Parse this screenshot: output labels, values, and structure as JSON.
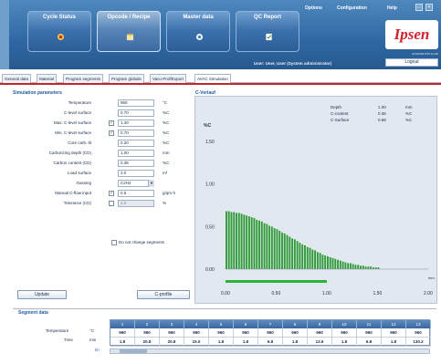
{
  "header": {
    "nav": [
      {
        "label": "Cycle Status",
        "icon": "cycle-status-icon"
      },
      {
        "label": "Opcode / Recipe",
        "icon": "recipe-icon"
      },
      {
        "label": "Master data",
        "icon": "master-data-icon"
      },
      {
        "label": "QC Report",
        "icon": "qc-report-icon"
      }
    ],
    "menu": [
      "Options",
      "Configuration",
      "Help"
    ],
    "logo": "Ipsen",
    "datetime": "4/24/2009 8:55:11 AM",
    "user": "User: User, User (System administrator)",
    "logout": "Logout"
  },
  "tabs": [
    "General data",
    "Material",
    "Program segments",
    "Program globals",
    "Vacu-Prof/Export",
    "AVAC Simulation"
  ],
  "sim": {
    "title": "Simulation parameters",
    "rows": [
      {
        "label": "Temperature",
        "value": "960",
        "unit": "°C",
        "check": false,
        "checked": false,
        "disabled": false
      },
      {
        "label": "C-level surface",
        "value": "0.70",
        "unit": "%C",
        "check": false,
        "checked": false,
        "disabled": false
      },
      {
        "label": "Max. C-level surface",
        "value": "1.40",
        "unit": "%C",
        "check": true,
        "checked": true,
        "disabled": false
      },
      {
        "label": "Min. C-level surface",
        "value": "0.70",
        "unit": "%C",
        "check": true,
        "checked": true,
        "disabled": false
      },
      {
        "label": "Core carb.-lit",
        "value": "0.20",
        "unit": "%C",
        "check": false,
        "checked": false,
        "disabled": false
      },
      {
        "label": "Carburizing depth (CD)",
        "value": "1.00",
        "unit": "mm",
        "check": false,
        "checked": false,
        "disabled": false
      },
      {
        "label": "Carbon content (CD)",
        "value": "0.36",
        "unit": "%C",
        "check": false,
        "checked": false,
        "disabled": false
      },
      {
        "label": "Load surface",
        "value": "3.0",
        "unit": "m²",
        "check": false,
        "checked": false,
        "disabled": false
      },
      {
        "label": "Gassing",
        "value": "C2H2",
        "unit": "",
        "check": false,
        "checked": false,
        "disabled": false,
        "select": true
      },
      {
        "label": "Manual C-flow input",
        "value": "0.5",
        "unit": "g/qm·h",
        "check": true,
        "checked": true,
        "disabled": false
      },
      {
        "label": "Tolerance (CD)",
        "value": "2.0",
        "unit": "%",
        "check": true,
        "checked": false,
        "disabled": true
      }
    ],
    "no_change": "Do not change segments",
    "update": "Update",
    "cprofile": "C-profile"
  },
  "chart_panel": {
    "title": "C-Verlauf"
  },
  "chart_data": {
    "type": "bar",
    "ylabel": "%C",
    "xlabel": "mm",
    "ylim": [
      0,
      1.5
    ],
    "xlim": [
      0,
      2.0
    ],
    "yticks": [
      "0.00",
      "0.50",
      "1.00",
      "1.50"
    ],
    "xticks": [
      "0.00",
      "0.50",
      "1.00",
      "1.50",
      "2.00"
    ],
    "legend": [
      {
        "name": "Depth",
        "value": "1.00",
        "unit": "mm"
      },
      {
        "name": "C-content",
        "value": "0.36",
        "unit": "%C"
      },
      {
        "name": "C-Surface",
        "value": "0.68",
        "unit": "%C"
      }
    ],
    "bar_x_start": 0.0,
    "bar_x_step": 0.025,
    "values": [
      0.68,
      0.68,
      0.67,
      0.67,
      0.66,
      0.66,
      0.65,
      0.64,
      0.63,
      0.62,
      0.61,
      0.6,
      0.58,
      0.57,
      0.56,
      0.54,
      0.53,
      0.51,
      0.5,
      0.48,
      0.47,
      0.45,
      0.43,
      0.42,
      0.4,
      0.38,
      0.36,
      0.35,
      0.33,
      0.31,
      0.29,
      0.28,
      0.26,
      0.25,
      0.23,
      0.22,
      0.2,
      0.19,
      0.17,
      0.16,
      0.15,
      0.14,
      0.13,
      0.12,
      0.11,
      0.1,
      0.09,
      0.08,
      0.07,
      0.07,
      0.06,
      0.05,
      0.05,
      0.04,
      0.04,
      0.03,
      0.03,
      0.03,
      0.02,
      0.02,
      0.02
    ],
    "colors": {
      "bar": "#2f9a36",
      "baseline": "#2ab338"
    }
  },
  "segments": {
    "title": "Segment data",
    "row_labels": [
      {
        "label": "Temperature",
        "unit": "°C"
      },
      {
        "label": "Time",
        "unit": "min"
      }
    ],
    "extra_label": "kh",
    "columns": [
      "1",
      "2",
      "3",
      "4",
      "5",
      "6",
      "7",
      "8",
      "9",
      "10",
      "11",
      "12",
      "13"
    ],
    "temperature": [
      "960",
      "960",
      "960",
      "960",
      "960",
      "960",
      "960",
      "960",
      "960",
      "960",
      "960",
      "960",
      "960"
    ],
    "time": [
      "1.8",
      "20.8",
      "20.8",
      "15.0",
      "1.8",
      "1.8",
      "6.8",
      "1.8",
      "13.6",
      "1.8",
      "6.8",
      "1.8",
      "130.2"
    ]
  }
}
